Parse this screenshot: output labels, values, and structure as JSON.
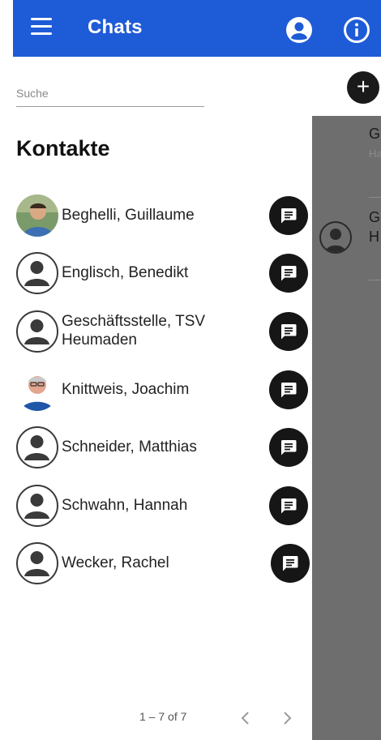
{
  "appbar": {
    "title": "Chats",
    "menu_icon": "menu-icon",
    "account_icon": "account-circle-icon",
    "info_icon": "info-icon",
    "color": "#1e5bd6"
  },
  "search": {
    "placeholder": "Suche",
    "value": ""
  },
  "contacts_section": {
    "title": "Kontakte"
  },
  "contacts": [
    {
      "name": "Beghelli, Guillaume",
      "avatar": "photo"
    },
    {
      "name": "Englisch, Benedikt",
      "avatar": "default"
    },
    {
      "name_line1": "Geschäftsstelle, TSV",
      "name_line2": "Heumaden",
      "avatar": "default"
    },
    {
      "name": "Knittweis, Joachim",
      "avatar": "photo"
    },
    {
      "name": "Schneider, Matthias",
      "avatar": "default"
    },
    {
      "name": "Schwahn, Hannah",
      "avatar": "default"
    },
    {
      "name": "Wecker, Rachel",
      "avatar": "default"
    }
  ],
  "pagination": {
    "range": "1 – 7 of 7"
  },
  "background_chats": [
    {
      "initial": "G",
      "sub": "Ha"
    },
    {
      "initial": "G",
      "sub": "H"
    }
  ]
}
